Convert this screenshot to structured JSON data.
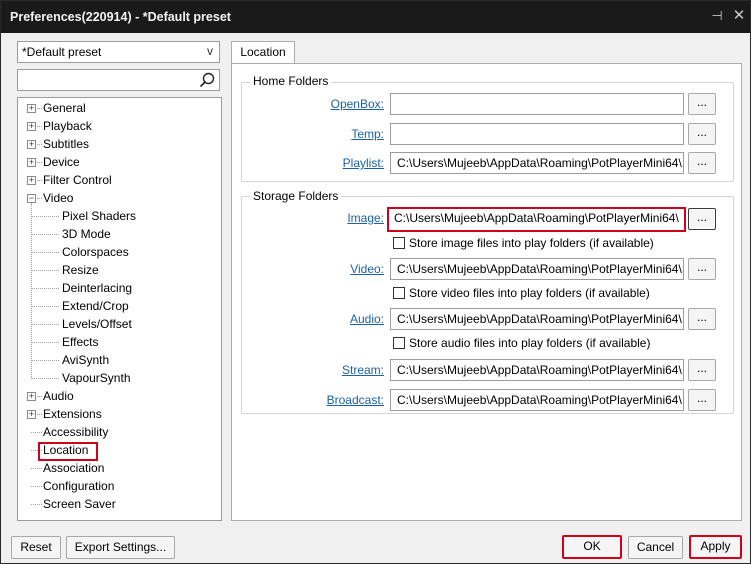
{
  "window": {
    "title": "Preferences(220914) - *Default preset",
    "pin_glyph": "⊣",
    "close_glyph": "✕"
  },
  "preset": {
    "value": "*Default preset",
    "arrow": "v"
  },
  "search": {
    "value": "",
    "placeholder": ""
  },
  "tree": {
    "items": [
      {
        "label": "General",
        "expander": "+"
      },
      {
        "label": "Playback",
        "expander": "+"
      },
      {
        "label": "Subtitles",
        "expander": "+"
      },
      {
        "label": "Device",
        "expander": "+"
      },
      {
        "label": "Filter Control",
        "expander": "+"
      },
      {
        "label": "Video",
        "expander": "−"
      },
      {
        "label": "Pixel Shaders"
      },
      {
        "label": "3D Mode"
      },
      {
        "label": "Colorspaces"
      },
      {
        "label": "Resize"
      },
      {
        "label": "Deinterlacing"
      },
      {
        "label": "Extend/Crop"
      },
      {
        "label": "Levels/Offset"
      },
      {
        "label": "Effects"
      },
      {
        "label": "AviSynth"
      },
      {
        "label": "VapourSynth"
      },
      {
        "label": "Audio",
        "expander": "+"
      },
      {
        "label": "Extensions",
        "expander": "+"
      },
      {
        "label": "Accessibility"
      },
      {
        "label": "Location",
        "selected": true
      },
      {
        "label": "Association"
      },
      {
        "label": "Configuration"
      },
      {
        "label": "Screen Saver"
      }
    ]
  },
  "tab": {
    "label": "Location"
  },
  "home_folders": {
    "legend": "Home Folders",
    "rows": [
      {
        "label": "OpenBox:",
        "value": "",
        "button": "..."
      },
      {
        "label": "Temp:",
        "value": "",
        "button": "..."
      },
      {
        "label": "Playlist:",
        "value": "C:\\Users\\Mujeeb\\AppData\\Roaming\\PotPlayerMini64\\",
        "button": "..."
      }
    ]
  },
  "storage_folders": {
    "legend": "Storage Folders",
    "image": {
      "label": "Image:",
      "value": "C:\\Users\\Mujeeb\\AppData\\Roaming\\PotPlayerMini64\\",
      "button": "...",
      "check": "Store image files into play folders (if available)"
    },
    "video": {
      "label": "Video:",
      "value": "C:\\Users\\Mujeeb\\AppData\\Roaming\\PotPlayerMini64\\",
      "button": "...",
      "check": "Store video files into play folders (if available)"
    },
    "audio": {
      "label": "Audio:",
      "value": "C:\\Users\\Mujeeb\\AppData\\Roaming\\PotPlayerMini64\\",
      "button": "...",
      "check": "Store audio files into play folders (if available)"
    },
    "stream": {
      "label": "Stream:",
      "value": "C:\\Users\\Mujeeb\\AppData\\Roaming\\PotPlayerMini64\\",
      "button": "..."
    },
    "broadcast": {
      "label": "Broadcast:",
      "value": "C:\\Users\\Mujeeb\\AppData\\Roaming\\PotPlayerMini64\\",
      "button": "..."
    }
  },
  "footer": {
    "reset": "Reset",
    "export": "Export Settings...",
    "ok": "OK",
    "cancel": "Cancel",
    "apply": "Apply"
  },
  "colors": {
    "highlight": "#d0021b",
    "link": "#1b62a8",
    "titlebar": "#1a1a1a"
  }
}
